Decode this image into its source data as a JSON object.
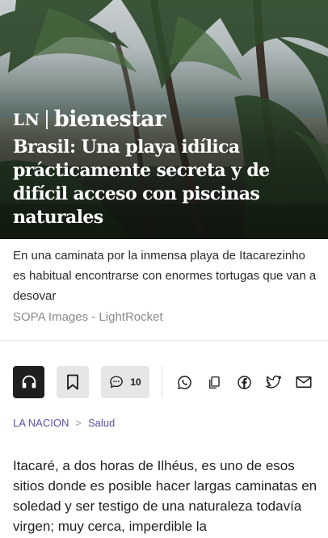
{
  "hero": {
    "brand_short": "LN",
    "brand_section": "bienestar",
    "title": "Brasil: Una playa idílica prácticamente secreta y de difícil acceso con piscinas naturales"
  },
  "photo": {
    "caption": "En una caminata por la inmensa playa de Itacarezinho es habitual encontrarse con enormes tortugas que van a desovar",
    "credit": "SOPA Images - LightRocket"
  },
  "actions": {
    "listen_icon": "headphones-icon",
    "save_icon": "bookmark-icon",
    "comments_icon": "comment-bubble-icon",
    "comments_count": "10",
    "share": [
      "whatsapp-icon",
      "copy-icon",
      "facebook-icon",
      "twitter-icon",
      "email-icon"
    ]
  },
  "breadcrumb": {
    "home": "LA NACION",
    "separator": ">",
    "section": "Salud"
  },
  "article": {
    "lead": "Itacaré, a dos horas de Ilhéus, es uno de esos sitios donde es posible hacer largas caminatas en soledad y ser testigo de una naturaleza todavía virgen; muy cerca, imperdible la"
  },
  "colors": {
    "accent": "#5b4fa8",
    "dark_button": "#1f1f1f",
    "light_button": "#e6e6e6"
  }
}
